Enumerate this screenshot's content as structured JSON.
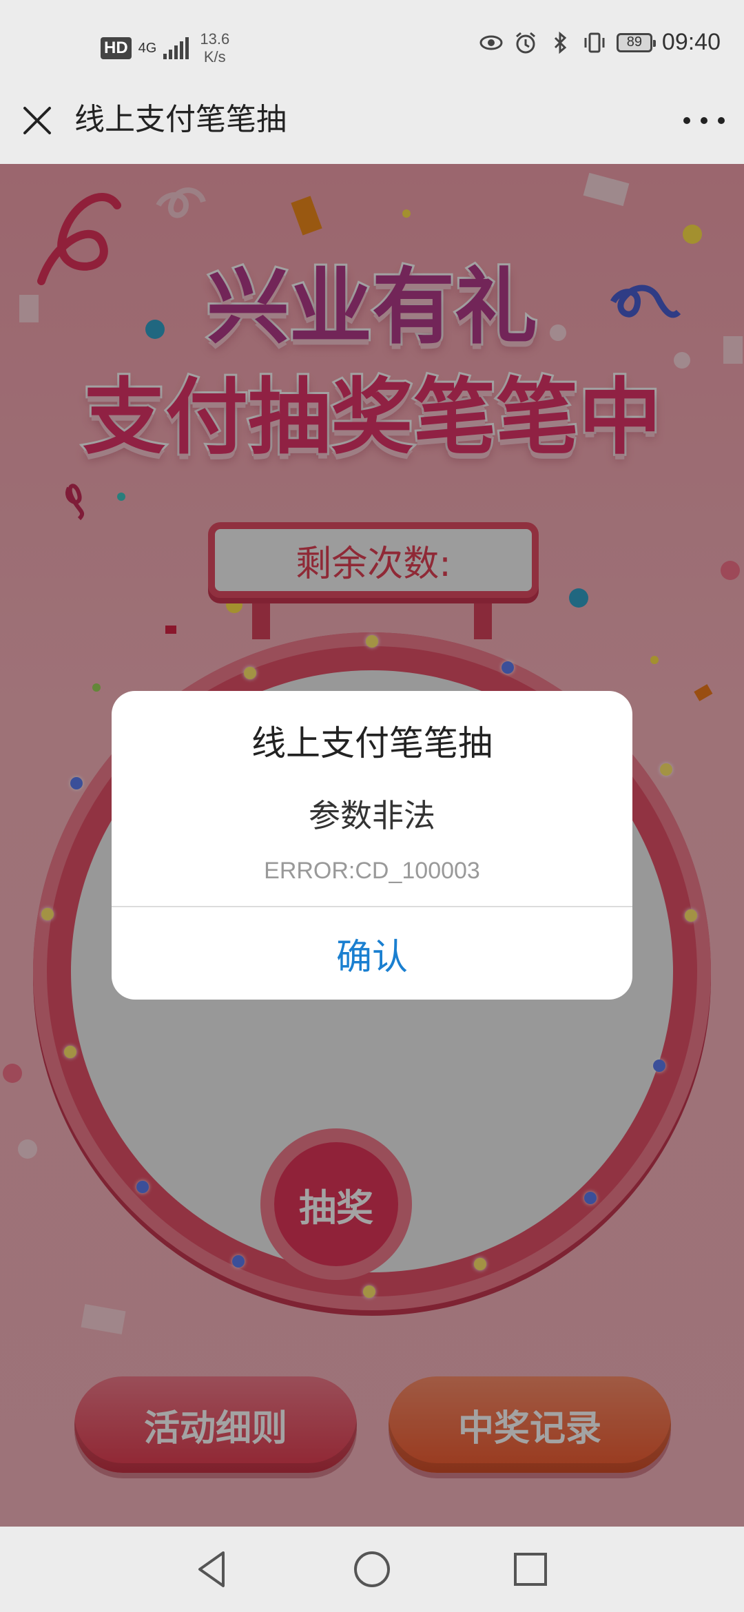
{
  "status_bar": {
    "hd": "HD",
    "network": "4G",
    "net_speed_value": "13.6",
    "net_speed_unit": "K/s",
    "battery": "89",
    "time": "09:40",
    "icons": [
      "eye-icon",
      "alarm-icon",
      "bluetooth-icon",
      "vibrate-icon"
    ]
  },
  "title_bar": {
    "title": "线上支付笔笔抽",
    "close_icon": "close-icon",
    "more_icon": "more-icon"
  },
  "banner": {
    "line1": "兴业有礼",
    "line2": "支付抽奖笔笔中"
  },
  "remaining": {
    "label": "剩余次数:"
  },
  "wheel": {
    "hub_text": "抽奖"
  },
  "buttons": {
    "rules": "活动细则",
    "records": "中奖记录"
  },
  "dialog": {
    "title": "线上支付笔笔抽",
    "message": "参数非法",
    "code": "ERROR:CD_100003",
    "confirm": "确认"
  },
  "nav_bar": {
    "icons": [
      "back-icon",
      "home-icon",
      "recents-icon"
    ]
  },
  "colors": {
    "accent": "#1a7fd0",
    "page_bg": "#f4a7b1",
    "wheel_rim": "#e35168",
    "rules_button": "#e23a4e",
    "records_button": "#f05a2f"
  }
}
